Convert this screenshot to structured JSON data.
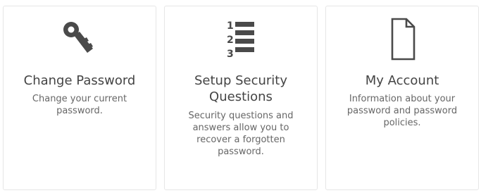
{
  "cards": [
    {
      "icon": "key-icon",
      "title": "Change Password",
      "description": "Change your current password."
    },
    {
      "icon": "numbered-list-icon",
      "title": "Setup Security Questions",
      "description": "Security questions and answers allow you to recover a forgotten password.",
      "list_numbers": [
        "1",
        "2",
        "3"
      ]
    },
    {
      "icon": "document-icon",
      "title": "My Account",
      "description": "Information about your password and password policies."
    }
  ],
  "colors": {
    "icon": "#4a4a4a",
    "title": "#444444",
    "description": "#666666",
    "card_border": "#e6e6e6"
  }
}
